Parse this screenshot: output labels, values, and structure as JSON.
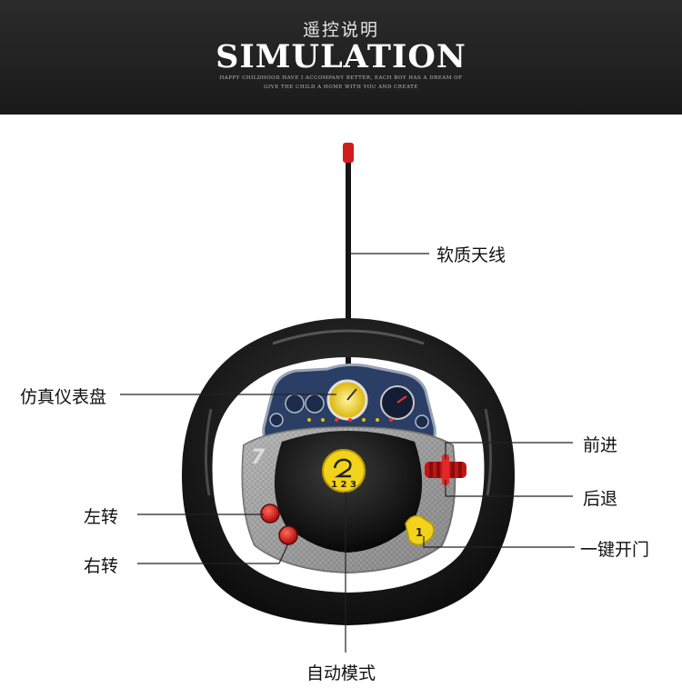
{
  "header": {
    "subtitle": "遥控说明",
    "title": "SIMULATION",
    "tagline_line1": "HAPPY CHILDHOOD HAVE I ACCOMPANY BETTER, EACH BOY HAS A DREAM OF",
    "tagline_line2": "GIVE THE CHILD A HOME WITH YOU AND CREATE"
  },
  "product": {
    "button_digits": "1 2 3",
    "door_button_digit": "1"
  },
  "callouts": {
    "antenna": "软质天线",
    "dashboard": "仿真仪表盘",
    "forward": "前进",
    "backward": "后退",
    "turn_left": "左转",
    "turn_right": "右转",
    "door": "一键开门",
    "auto_mode": "自动模式"
  },
  "colors": {
    "header_bg": "#1f1f1f",
    "wheel": "#1c1c1c",
    "accent_red": "#d42020",
    "accent_yellow": "#f2d21a"
  }
}
